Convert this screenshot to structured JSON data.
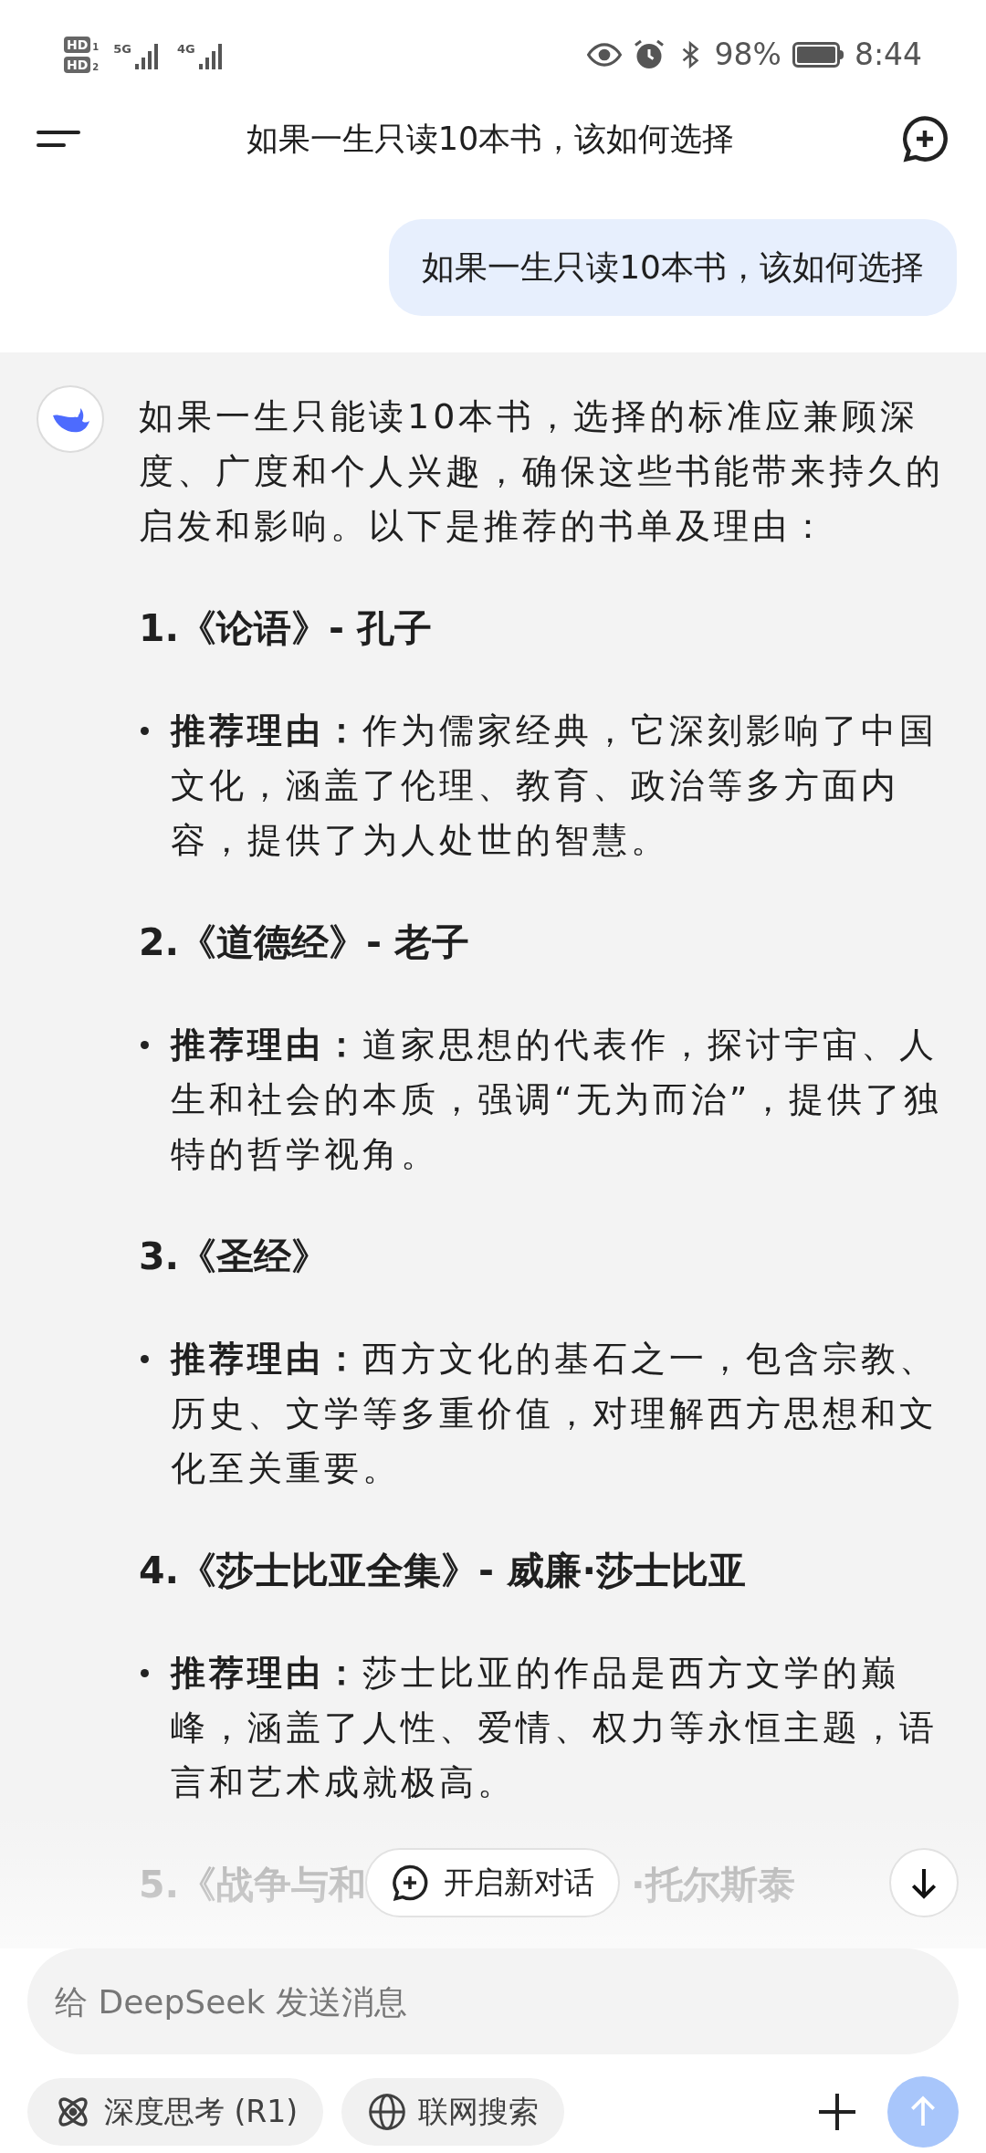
{
  "status_bar": {
    "sims": [
      {
        "label": "HD",
        "slot": "1"
      },
      {
        "label": "HD",
        "slot": "2"
      }
    ],
    "networks": [
      "5G",
      "4G"
    ],
    "battery": "98%",
    "time": "8:44"
  },
  "header": {
    "title": "如果一生只读10本书，该如何选择"
  },
  "user_message": "如果一生只读10本书，该如何选择",
  "answer": {
    "intro": "如果一生只能读10本书，选择的标准应兼顾深度、广度和个人兴趣，确保这些书能带来持久的启发和影响。以下是推荐的书单及理由：",
    "sections": [
      {
        "heading": "1.《论语》- 孔子",
        "bullets": [
          "**推荐理由：**作为儒家经典，它深刻影响了中国文化，涵盖了伦理、教育、政治等多方面内容，提供了为人处世的智慧。"
        ]
      },
      {
        "heading": "2.《道德经》- 老子",
        "bullets": [
          "**推荐理由：**道家思想的代表作，探讨宇宙、人生和社会的本质，强调“无为而治”，提供了独特的哲学视角。"
        ]
      },
      {
        "heading": "3.《圣经》",
        "bullets": [
          "**推荐理由：**西方文化的基石之一，包含宗教、历史、文学等多重价值，对理解西方思想和文化至关重要。"
        ]
      },
      {
        "heading": "4.《莎士比亚全集》- 威廉·莎士比亚",
        "bullets": [
          "**推荐理由：**莎士比亚的作品是西方文学的巅峰，涵盖了人性、爱情、权力等永恒主题，语言和艺术成就极高。"
        ]
      }
    ],
    "partial_heading": [
      "5.《战争与和",
      "·托尔斯泰"
    ]
  },
  "new_chat_button": "开启新对话",
  "composer": {
    "placeholder": "给 DeepSeek 发送消息",
    "chips": [
      {
        "label": "深度思考 (R1)",
        "kind": "think",
        "selected": false
      },
      {
        "label": "联网搜索",
        "kind": "web",
        "selected": false
      }
    ],
    "send_disabled": true
  }
}
